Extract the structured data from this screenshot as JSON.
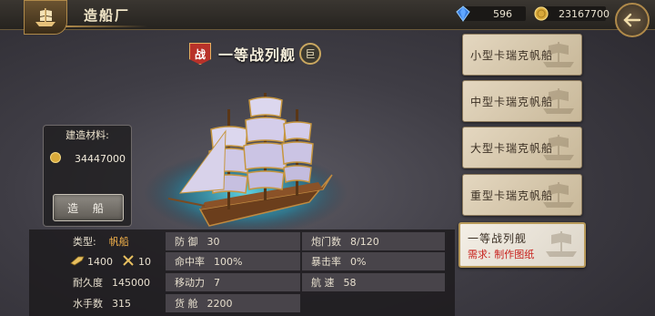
{
  "header": {
    "title": "造船厂",
    "gems": "596",
    "gold": "23167700"
  },
  "ship": {
    "name": "一等战列舰",
    "class_badge": "战",
    "size_badge": "巨"
  },
  "materials": {
    "label": "建造材料:",
    "amount": "34447000",
    "build_button": "造 船"
  },
  "ship_list": [
    {
      "label": "小型卡瑞克帆船"
    },
    {
      "label": "中型卡瑞克帆船"
    },
    {
      "label": "大型卡瑞克帆船"
    },
    {
      "label": "重型卡瑞克帆船"
    },
    {
      "label": "一等战列舰",
      "requirement": "需求: 制作图纸",
      "selected": true
    }
  ],
  "stats": {
    "type_label": "类型:",
    "type_value": "帆船",
    "attack_value": "1400",
    "swords_value": "10",
    "durability_label": "耐久度",
    "durability_value": "145000",
    "sailors_label": "水手数",
    "sailors_value": "315",
    "defense_label": "防 御",
    "defense_value": "30",
    "accuracy_label": "命中率",
    "accuracy_value": "100%",
    "mobility_label": "移动力",
    "mobility_value": "7",
    "cargo_label": "货 舱",
    "cargo_value": "2200",
    "cannon_label": "炮门数",
    "cannon_value": "8/120",
    "crit_label": "暴击率",
    "crit_value": "0%",
    "speed_label": "航 速",
    "speed_value": "58"
  },
  "colors": {
    "gold_accent": "#b08a4a",
    "requirement_red": "#c8201c",
    "type_orange": "#f3b24a"
  },
  "icons": [
    "ship-emblem-icon",
    "blue-gem-icon",
    "gold-coin-icon",
    "back-arrow-icon",
    "attack-icon",
    "crossed-swords-icon"
  ]
}
